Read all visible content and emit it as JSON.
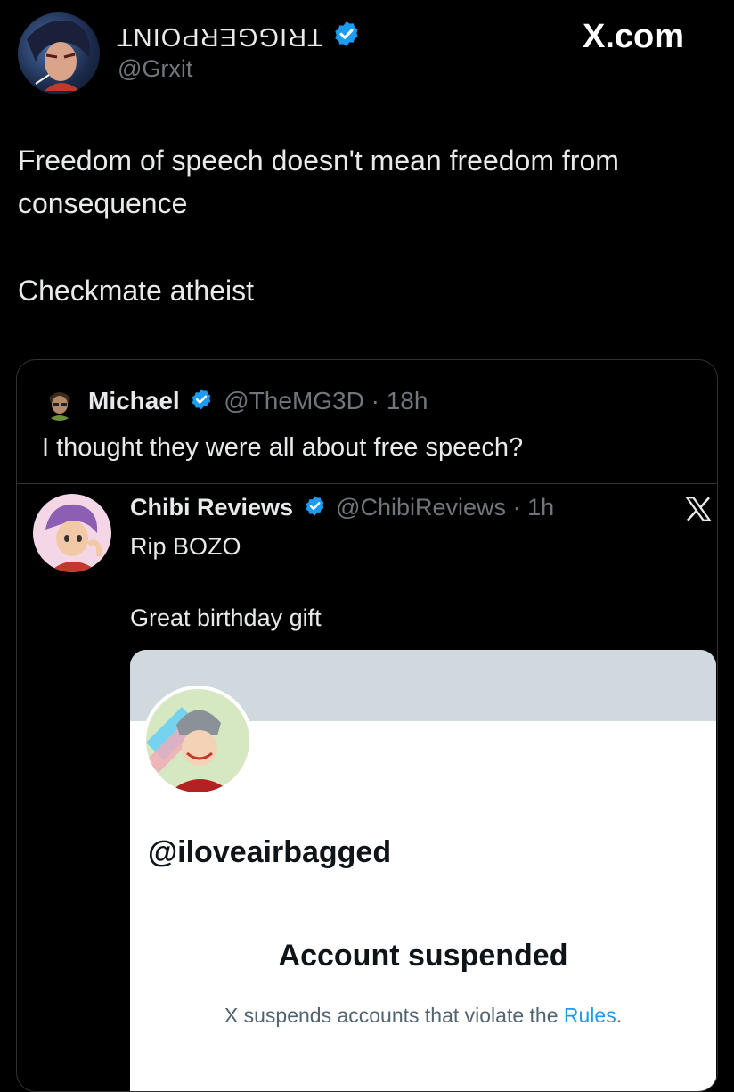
{
  "header": {
    "display_name": "TRIGGERPOINT",
    "handle": "@Grxit",
    "site": "X.com"
  },
  "tweet": {
    "line1": "Freedom of speech doesn't mean freedom from",
    "line2": "consequence",
    "line3": "Checkmate atheist"
  },
  "quote": {
    "name": "Michael",
    "handle": "@TheMG3D",
    "time": "· 18h",
    "text": "I thought they were all about free speech?"
  },
  "nested": {
    "name": "Chibi Reviews",
    "handle": "@ChibiReviews",
    "time": "· 1h",
    "line1": "Rip BOZO",
    "line2": "Great birthday gift"
  },
  "suspended_card": {
    "handle": "@iloveairbagged",
    "title": "Account suspended",
    "message_prefix": "X suspends accounts that violate the ",
    "rules_link": "Rules",
    "message_suffix": "."
  },
  "colors": {
    "verified_blue": "#1d9bf0",
    "link_blue": "#1d9bf0",
    "muted": "#71767b"
  }
}
